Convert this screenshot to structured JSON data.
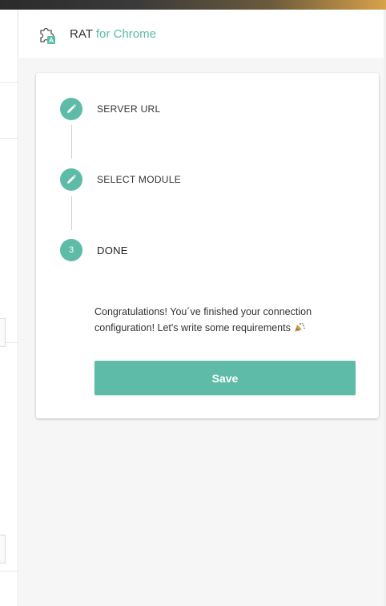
{
  "app": {
    "name": "RAT",
    "subtitle": "for Chrome",
    "accent_color": "#5dbba7"
  },
  "stepper": {
    "steps": [
      {
        "label": "SERVER URL",
        "state": "completed",
        "icon": "pencil-icon"
      },
      {
        "label": "SELECT MODULE",
        "state": "completed",
        "icon": "pencil-icon"
      },
      {
        "label": "DONE",
        "state": "active",
        "number": "3"
      }
    ]
  },
  "content": {
    "message": "Congratulations! You´ve finished your connection configuration! Let's write some requirements",
    "emoji_icon": "party-popper-icon"
  },
  "actions": {
    "save_label": "Save"
  }
}
